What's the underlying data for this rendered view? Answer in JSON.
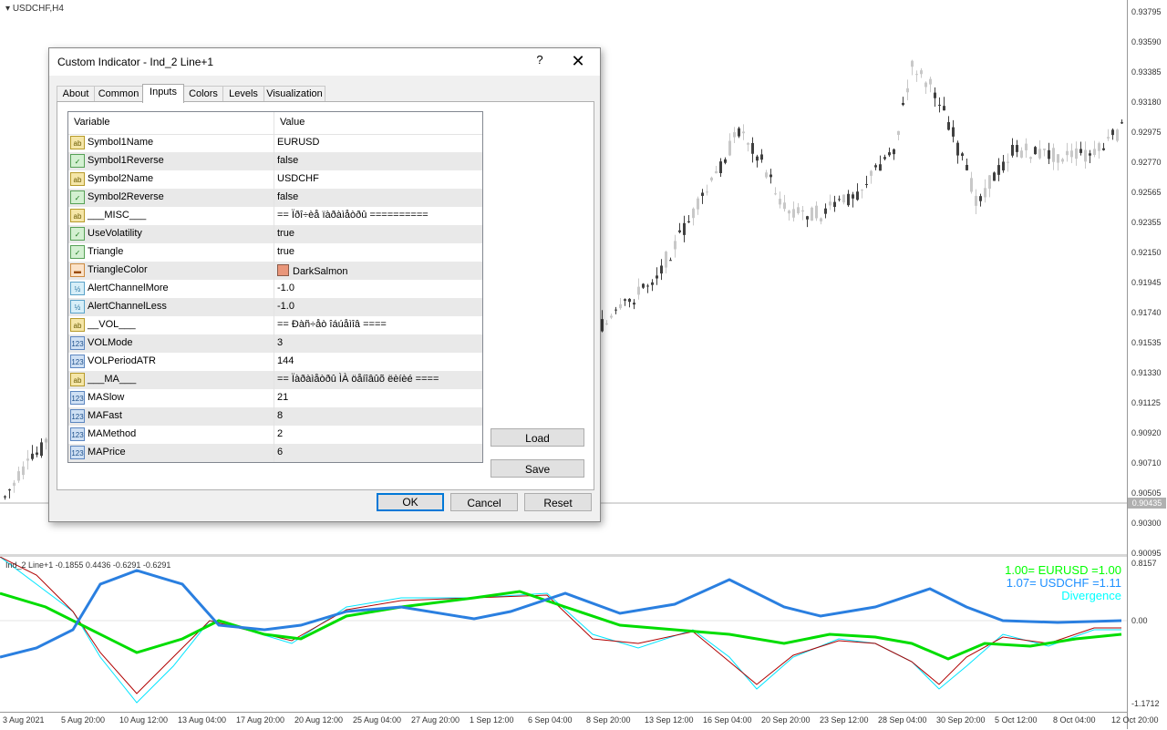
{
  "chart": {
    "symbol_label": "USDCHF,H4",
    "price_ticks": [
      "0.93795",
      "0.93590",
      "0.93385",
      "0.93180",
      "0.92975",
      "0.92770",
      "0.92565",
      "0.92355",
      "0.92150",
      "0.91945",
      "0.91740",
      "0.91535",
      "0.91330",
      "0.91125",
      "0.90920",
      "0.90710",
      "0.90505",
      "0.90300",
      "0.90095"
    ],
    "current_price": "0.90435",
    "sub_ticks": [
      "0.8157",
      "0.00",
      "-1.1712"
    ],
    "time_labels": [
      "3 Aug 2021",
      "5 Aug 20:00",
      "10 Aug 12:00",
      "13 Aug 04:00",
      "17 Aug 20:00",
      "20 Aug 12:00",
      "25 Aug 04:00",
      "27 Aug 20:00",
      "1 Sep 12:00",
      "6 Sep 04:00",
      "8 Sep 20:00",
      "13 Sep 12:00",
      "16 Sep 04:00",
      "20 Sep 20:00",
      "23 Sep 12:00",
      "28 Sep 04:00",
      "30 Sep 20:00",
      "5 Oct 12:00",
      "8 Oct 04:00",
      "12 Oct 20:00"
    ],
    "indicator_label": "Ind_2 Line+1 -0.1855 0.4436 -0.6291 -0.6291",
    "legend": [
      {
        "text": "1.00= EURUSD  =1.00",
        "color": "#00ff00"
      },
      {
        "text": "1.07= USDCHF  =1.11",
        "color": "#1e90ff"
      },
      {
        "text": "Divergence",
        "color": "#00ffff"
      }
    ]
  },
  "dialog": {
    "title": "Custom Indicator - Ind_2 Line+1",
    "help": "?",
    "close": "✕",
    "tabs": [
      "About",
      "Common",
      "Inputs",
      "Colors",
      "Levels",
      "Visualization"
    ],
    "active_tab": "Inputs",
    "columns": [
      "Variable",
      "Value"
    ],
    "rows": [
      {
        "icon": "ab",
        "name": "Symbol1Name",
        "value": "EURUSD"
      },
      {
        "icon": "bool",
        "name": "Symbol1Reverse",
        "value": "false"
      },
      {
        "icon": "ab",
        "name": "Symbol2Name",
        "value": "USDCHF"
      },
      {
        "icon": "bool",
        "name": "Symbol2Reverse",
        "value": "false"
      },
      {
        "icon": "ab",
        "name": "___MISC___",
        "value": "== Ïðî÷èå ïàðàìåòðû =========="
      },
      {
        "icon": "bool",
        "name": "UseVolatility",
        "value": "true"
      },
      {
        "icon": "bool",
        "name": "Triangle",
        "value": "true"
      },
      {
        "icon": "clr",
        "name": "TriangleColor",
        "value": "DarkSalmon",
        "swatch": "#e9967a"
      },
      {
        "icon": "dbl",
        "name": "AlertChannelMore",
        "value": "-1.0"
      },
      {
        "icon": "dbl",
        "name": "AlertChannelLess",
        "value": "-1.0"
      },
      {
        "icon": "ab",
        "name": "__VOL___",
        "value": "== Ðàñ÷åò îáúåìîâ ===="
      },
      {
        "icon": "int",
        "name": "VOLMode",
        "value": "3"
      },
      {
        "icon": "int",
        "name": "VOLPeriodATR",
        "value": "144"
      },
      {
        "icon": "ab",
        "name": "___MA___",
        "value": "== Ïàðàìåòðû ÌÀ öåíîâûõ ëèíèé ===="
      },
      {
        "icon": "int",
        "name": "MASlow",
        "value": "21"
      },
      {
        "icon": "int",
        "name": "MAFast",
        "value": "8"
      },
      {
        "icon": "int",
        "name": "MAMethod",
        "value": "2"
      },
      {
        "icon": "int",
        "name": "MAPrice",
        "value": "6"
      }
    ],
    "icon_text": {
      "ab": "ab",
      "bool": "✓",
      "dbl": "½",
      "int": "123",
      "clr": "▬"
    },
    "buttons": {
      "load": "Load",
      "save": "Save",
      "ok": "OK",
      "cancel": "Cancel",
      "reset": "Reset"
    }
  }
}
